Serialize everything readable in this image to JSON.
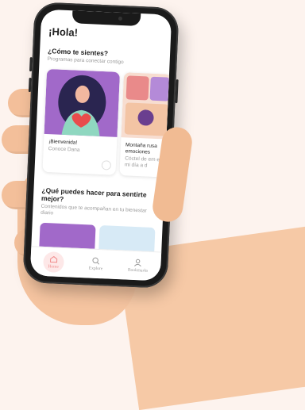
{
  "app": {
    "greeting": "¡Hola!"
  },
  "section_feel": {
    "title": "¿Cómo te sientes?",
    "subtitle": "Programas para conectar contigo",
    "cards": [
      {
        "title": "¡Bienvenida!",
        "subtitle": "Conoce Dana"
      },
      {
        "title": "Montaña rusa emociones",
        "subtitle": "Cóctel de em en mi día a d"
      }
    ]
  },
  "section_do": {
    "title": "¿Qué puedes hacer para sentirte mejor?",
    "subtitle": "Contenidos que te acompañan en tu bienestar diario"
  },
  "tabbar": {
    "items": [
      {
        "label": "Home",
        "icon": "home-icon"
      },
      {
        "label": "Explore",
        "icon": "search-icon"
      },
      {
        "label": "Bookmarks",
        "icon": "user-icon"
      }
    ]
  },
  "colors": {
    "accent": "#f08a8a",
    "purple": "#a169c9",
    "background": "#fdf3ee"
  }
}
